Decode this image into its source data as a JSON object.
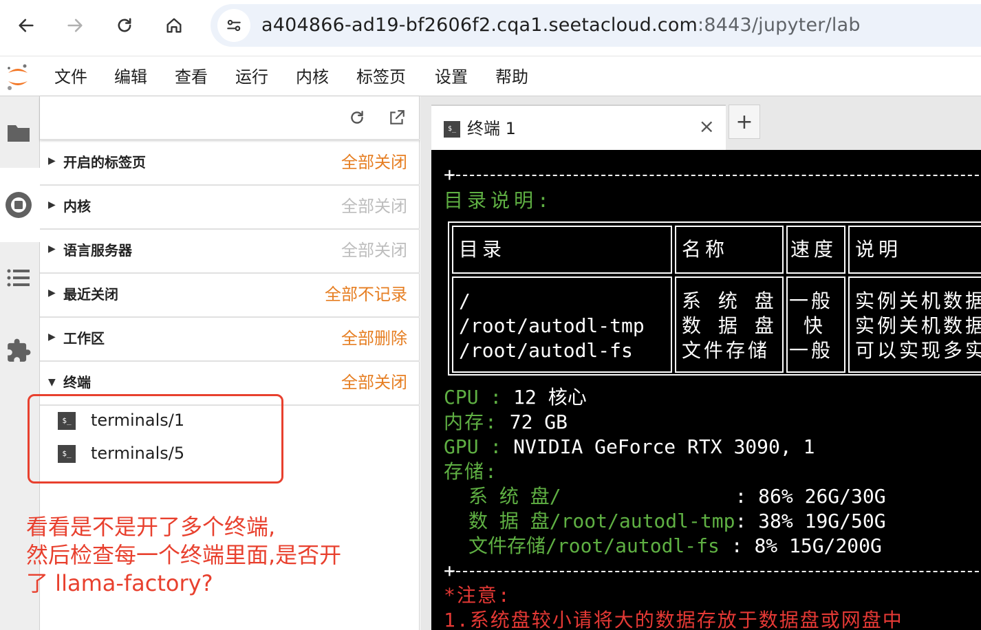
{
  "browser": {
    "url_host": "a404866-ad19-bf2606f2.cqa1.seetacloud.com",
    "url_path": ":8443/jupyter/lab"
  },
  "menu": [
    "文件",
    "编辑",
    "查看",
    "运行",
    "内核",
    "标签页",
    "设置",
    "帮助"
  ],
  "sidebar": {
    "sections": [
      {
        "title": "开启的标签页",
        "action": "全部关闭",
        "enabled": true
      },
      {
        "title": "内核",
        "action": "全部关闭",
        "enabled": false
      },
      {
        "title": "语言服务器",
        "action": "全部关闭",
        "enabled": false
      },
      {
        "title": "最近关闭",
        "action": "全部不记录",
        "enabled": true
      },
      {
        "title": "工作区",
        "action": "全部删除",
        "enabled": true
      },
      {
        "title": "终端",
        "action": "全部关闭",
        "enabled": true
      }
    ],
    "terminals": [
      "terminals/1",
      "terminals/5"
    ],
    "term_icon": "$_"
  },
  "annotation": {
    "line1": "看看是不是开了多个终端,",
    "line2": "然后检查每一个终端里面,是否开",
    "line3": "了 llama-factory?"
  },
  "tab": {
    "label": "终端 1",
    "close": "×",
    "add": "+"
  },
  "terminal": {
    "dir_heading": "目录说明:",
    "table_headers": [
      "目录",
      "名称",
      "速度",
      "说明"
    ],
    "table_rows": [
      [
        "/",
        "系 统 盘",
        "一般",
        "实例关机数据"
      ],
      [
        "/root/autodl-tmp",
        "数 据 盘",
        " 快",
        "实例关机数据"
      ],
      [
        "/root/autodl-fs",
        "文件存储",
        "一般",
        "可以实现多实"
      ]
    ],
    "cpu_label": "CPU :",
    "cpu_value": " 12 核心",
    "mem_label": "内存:",
    "mem_value": " 72 GB",
    "gpu_label": "GPU :",
    "gpu_value": " NVIDIA GeForce RTX 3090, 1",
    "storage_label": "存储:",
    "storage_rows": [
      {
        "name": "系 统 盘/",
        "sep": "               :",
        "value": " 86% 26G/30G"
      },
      {
        "name": "数 据 盘/root/autodl-tmp",
        "sep": ":",
        "value": " 38% 19G/50G"
      },
      {
        "name": "文件存储/root/autodl-fs",
        "sep": " :",
        "value": " 8% 15G/200G"
      }
    ],
    "note_heading": "*注意:",
    "note_1": "1.系统盘较小请将大的数据存放于数据盘或网盘中"
  },
  "colors": {
    "accent_orange": "#e67e22",
    "annotation_red": "#e8402e",
    "terminal_green": "#5fb043"
  }
}
